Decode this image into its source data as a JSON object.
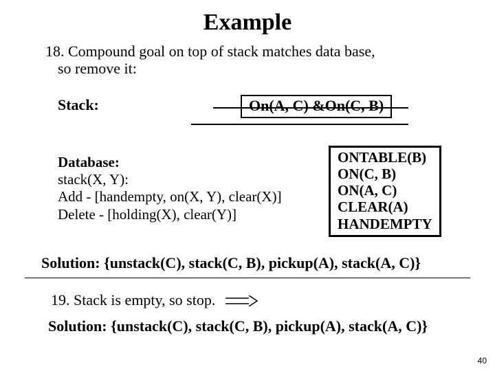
{
  "title": "Example",
  "step18": {
    "line1": "18. Compound goal on top of stack matches data base,",
    "line2": "so remove it:"
  },
  "stack_label": "Stack:",
  "goal_expr": "On(A, C) &On(C, B)",
  "database": {
    "heading": "Database:",
    "l1": "stack(X, Y):",
    "l2": "Add - [handempty, on(X, Y), clear(X)]",
    "l3": "Delete - [holding(X), clear(Y)]"
  },
  "facts": {
    "f1": "ONTABLE(B)",
    "f2": "ON(C, B)",
    "f3": "ON(A, C)",
    "f4": "CLEAR(A)",
    "f5": "HANDEMPTY"
  },
  "solution1": "Solution: {unstack(C), stack(C, B), pickup(A), stack(A, C)}",
  "step19": "19. Stack is empty, so stop.",
  "solution2": "Solution: {unstack(C), stack(C, B), pickup(A), stack(A, C)}",
  "page_number": "40"
}
